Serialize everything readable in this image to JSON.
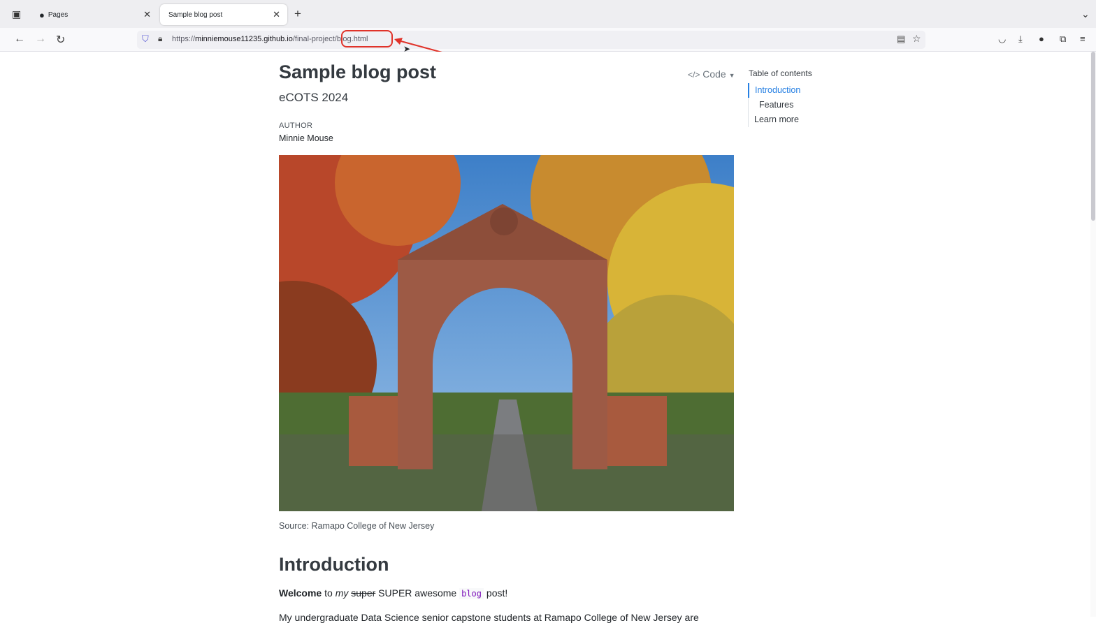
{
  "browser": {
    "tabs": [
      {
        "label": "Pages"
      },
      {
        "label": "Sample blog post"
      }
    ],
    "new_tab": "+",
    "url": {
      "prefix": "https://",
      "host": "minniemouse11235.github.io",
      "path": "/final-project/blog.html"
    }
  },
  "post": {
    "title": "Sample blog post",
    "subtitle": "eCOTS 2024",
    "author_label": "AUTHOR",
    "author": "Minnie Mouse",
    "code_button": "Code",
    "image_caption": "Source: Ramapo College of New Jersey",
    "section_heading": "Introduction",
    "para1": {
      "bold": "Welcome",
      "t1": " to ",
      "italic": "my",
      "strike": "super",
      "t2": " SUPER awesome ",
      "code": "blog",
      "t3": " post!"
    },
    "para2": "My undergraduate Data Science senior capstone students at Ramapo College of New Jersey are"
  },
  "toc": {
    "title": "Table of contents",
    "items": [
      {
        "label": "Introduction"
      },
      {
        "label": "Features"
      },
      {
        "label": "Learn more"
      }
    ]
  },
  "icons": [
    "tab-list-icon",
    "github-icon",
    "close-icon",
    "back-icon",
    "forward-icon",
    "reload-icon",
    "shield-icon",
    "lock-icon",
    "reader-icon",
    "star-icon",
    "pocket-icon",
    "download-icon",
    "account-icon",
    "extensions-icon",
    "menu-icon"
  ]
}
